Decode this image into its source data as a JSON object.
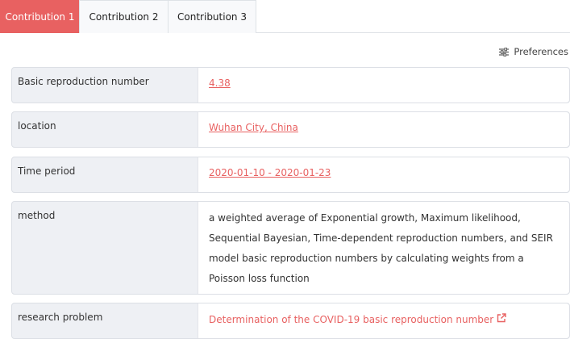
{
  "tabs": [
    {
      "label": "Contribution 1",
      "active": true
    },
    {
      "label": "Contribution 2",
      "active": false
    },
    {
      "label": "Contribution 3",
      "active": false
    }
  ],
  "preferences": {
    "label": "Preferences",
    "icon": "sliders-icon"
  },
  "rows": [
    {
      "label": "Basic reproduction number",
      "value": "4.38"
    },
    {
      "label": "location",
      "value": "Wuhan City, China"
    },
    {
      "label": "Time period",
      "value": "2020-01-10 - 2020-01-23"
    },
    {
      "label": "method",
      "value": "a weighted average of Exponential growth, Maximum likelihood, Sequential Bayesian, Time-dependent reproduction numbers, and SEIR model basic reproduction numbers by calculating weights from a Poisson loss function"
    },
    {
      "label": "research problem",
      "value": "Determination of the COVID-19 basic reproduction number",
      "icon": "external-link-icon"
    }
  ],
  "colors": {
    "accent": "#e86161",
    "label_bg": "#eef0f4",
    "border": "#dcdfe5"
  }
}
